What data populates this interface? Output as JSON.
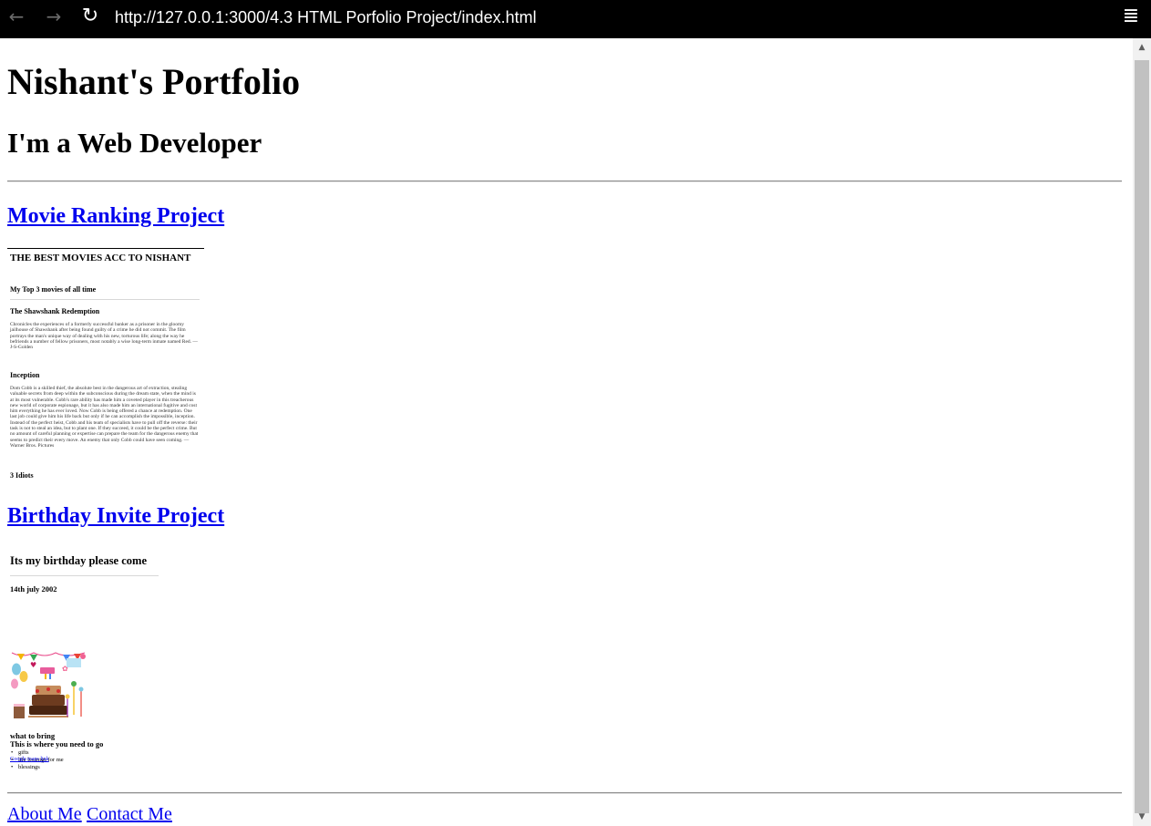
{
  "browser": {
    "url": "http://127.0.0.1:3000/4.3 HTML Porfolio Project/index.html",
    "back_icon": "←",
    "forward_icon": "→",
    "reload_icon": "↻",
    "menu_icon": "≣"
  },
  "scrollbar": {
    "up_icon": "▲",
    "down_icon": "▼"
  },
  "header": {
    "title": "Nishant's Portfolio",
    "subtitle": "I'm a Web Developer"
  },
  "projects": [
    {
      "link": "Movie Ranking Project",
      "preview": {
        "title": "THE BEST MOVIES ACC TO NISHANT",
        "subtitle": "My Top 3 movies of all time",
        "movies": [
          {
            "name": "The Shawshank Redemption",
            "description": "Chronicles the experiences of a formerly successful banker as a prisoner in the gloomy jailhouse of Shawshank after being found guilty of a crime he did not commit. The film portrays the man's unique way of dealing with his new, torturous life; along the way he befriends a number of fellow prisoners, most notably a wise long-term inmate named Red. —J-S-Golden"
          },
          {
            "name": "Inception",
            "description": "Dom Cobb is a skilled thief, the absolute best in the dangerous art of extraction, stealing valuable secrets from deep within the subconscious during the dream state, when the mind is at its most vulnerable. Cobb's rare ability has made him a coveted player in this treacherous new world of corporate espionage, but it has also made him an international fugitive and cost him everything he has ever loved. Now Cobb is being offered a chance at redemption. One last job could give him his life back but only if he can accomplish the impossible, inception. Instead of the perfect heist, Cobb and his team of specialists have to pull off the reverse: their task is not to steal an idea, but to plant one. If they succeed, it could be the perfect crime. But no amount of careful planning or expertise can prepare the team for the dangerous enemy that seems to predict their every move. An enemy that only Cobb could have seen coming. —Warner Bros. Pictures"
          },
          {
            "name": "3 Idiots"
          }
        ]
      }
    },
    {
      "link": "Birthday Invite Project",
      "preview": {
        "title": "Its my birthday please come",
        "date": "14th july 2002",
        "bring_heading": "what to bring",
        "bring_items": [
          "gifts",
          "life lessnigs for me",
          "blessings"
        ],
        "location_heading": "This is where you need to go",
        "map_link": "Google maps link"
      }
    }
  ],
  "footer": {
    "about": "About Me",
    "contact": "Contact Me"
  }
}
